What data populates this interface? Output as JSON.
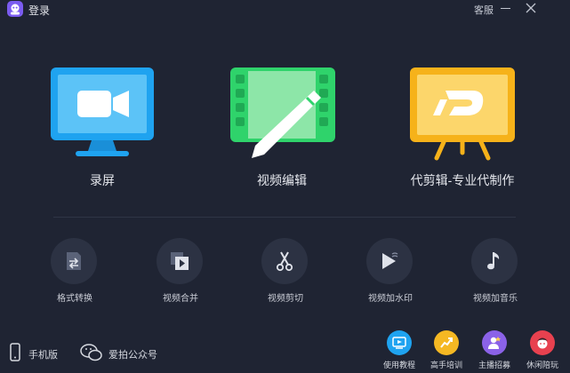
{
  "titlebar": {
    "login": "登录",
    "service": "客服"
  },
  "main": {
    "cards": [
      {
        "label": "录屏",
        "icon": "screen-record-icon",
        "color": "#1fa3f0"
      },
      {
        "label": "视频编辑",
        "icon": "video-edit-icon",
        "color": "#2fd36b"
      },
      {
        "label": "代剪辑-专业代制作",
        "icon": "pro-editing-icon",
        "color": "#f6b21a"
      }
    ]
  },
  "tools": [
    {
      "label": "格式转换",
      "icon": "format-convert-icon"
    },
    {
      "label": "视频合并",
      "icon": "video-merge-icon"
    },
    {
      "label": "视频剪切",
      "icon": "scissors-icon"
    },
    {
      "label": "视频加水印",
      "icon": "watermark-icon"
    },
    {
      "label": "视频加音乐",
      "icon": "music-note-icon"
    }
  ],
  "footer": {
    "mobile": "手机版",
    "wechat": "爱拍公众号",
    "promos": [
      {
        "label": "使用教程",
        "icon": "tutorial-icon",
        "color": "#1fa3f0"
      },
      {
        "label": "高手培训",
        "icon": "training-icon",
        "color": "#f5b823"
      },
      {
        "label": "主播招募",
        "icon": "streamer-recruit-icon",
        "color": "#8b62e8"
      },
      {
        "label": "休闲陪玩",
        "icon": "casual-play-icon",
        "color": "#e8414f"
      }
    ]
  }
}
